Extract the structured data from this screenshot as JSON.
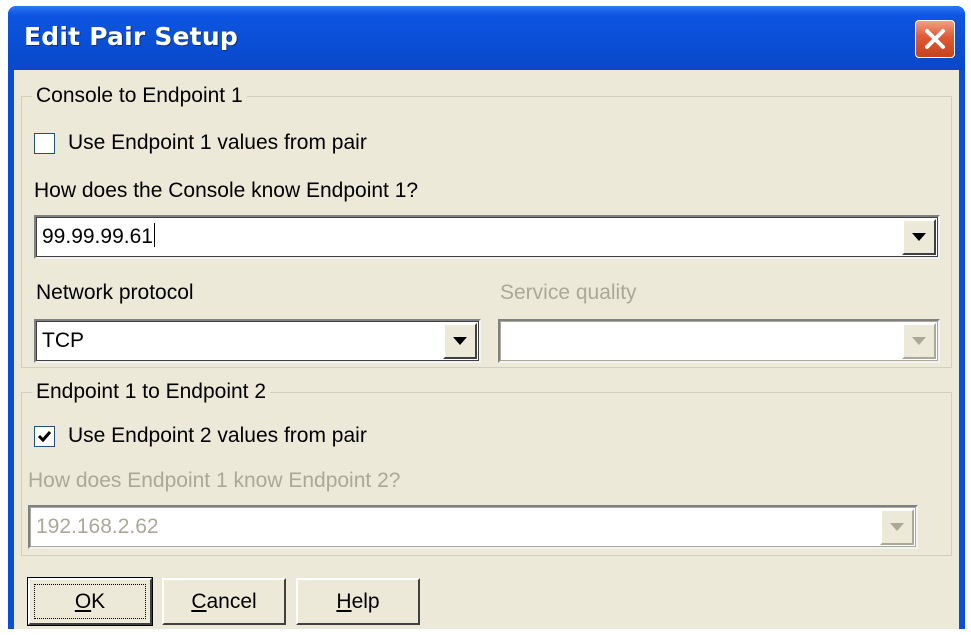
{
  "dialog": {
    "title": "Edit Pair Setup",
    "close_icon": "close-icon"
  },
  "console_group": {
    "legend": "Console to Endpoint 1",
    "use_values_label": "Use Endpoint 1 values from pair",
    "use_values_checked": false,
    "question": "How does the Console know Endpoint 1?",
    "address_value": "99.99.99.61",
    "protocol_label": "Network protocol",
    "protocol_value": "TCP",
    "service_quality_label": "Service quality",
    "service_quality_value": ""
  },
  "endpoint_group": {
    "legend": "Endpoint 1 to Endpoint 2",
    "use_values_label": "Use Endpoint 2 values from pair",
    "use_values_checked": true,
    "question": "How does Endpoint 1 know Endpoint 2?",
    "address_value": "192.168.2.62"
  },
  "buttons": {
    "ok_accel": "O",
    "ok_rest": "K",
    "cancel_accel": "C",
    "cancel_rest": "ancel",
    "help_accel": "H",
    "help_rest": "elp"
  },
  "colors": {
    "titlebar": "#0b4fd6",
    "dialog_face": "#ece9d8",
    "disabled_text": "#aca899",
    "close_button": "#dd5a34"
  }
}
